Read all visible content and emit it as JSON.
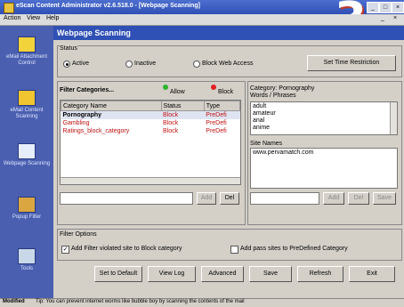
{
  "window": {
    "title": "eScan Content Administrator v2.6.518.0 - [Webpage Scanning]",
    "min": "_",
    "max": "□",
    "close": "×"
  },
  "overlay_number": "3",
  "menu": {
    "items": [
      "Action",
      "View",
      "Help"
    ],
    "child_min": "_",
    "child_close": "×"
  },
  "sidebar": {
    "items": [
      {
        "label": "eMail Attachment Control",
        "icon": "envelope-icon"
      },
      {
        "label": "eMail Content Scanning",
        "icon": "envelope-content-icon"
      },
      {
        "label": "Webpage Scanning",
        "icon": "webpage-icon"
      },
      {
        "label": "Popup Filter",
        "icon": "popup-filter-icon"
      },
      {
        "label": "Tools",
        "icon": "tools-icon"
      }
    ]
  },
  "header": {
    "title": "Webpage Scanning"
  },
  "status_group": {
    "title": "Status",
    "options": [
      "Active",
      "Inactive",
      "Block Web Access"
    ],
    "selected": "Active",
    "set_time_button": "Set Time Restriction"
  },
  "filter_categories": {
    "title": "Filter Categories...",
    "allow": "Allow",
    "block": "Block",
    "columns": [
      "Category Name",
      "Status",
      "Type"
    ],
    "rows": [
      {
        "name": "Pornography",
        "status": "Block",
        "type": "PreDefi",
        "selected": true
      },
      {
        "name": "Gambling",
        "status": "Block",
        "type": "PreDefi",
        "selected": false
      },
      {
        "name": "Ratings_block_category",
        "status": "Block",
        "type": "PreDefi",
        "selected": false
      }
    ],
    "add": "Add",
    "del": "Del"
  },
  "category_detail": {
    "category_label": "Category: Pornography",
    "words_label": "Words / Phrases",
    "words": [
      "adult",
      "amateur",
      "anal",
      "anime"
    ],
    "sites_label": "Site Names",
    "sites": [
      "www.pervamatch.com"
    ],
    "add": "Add",
    "del": "Del",
    "save": "Save"
  },
  "filter_options": {
    "title": "Filter Options",
    "opt1": "Add Filter violated site to Block category",
    "opt1_checked": true,
    "opt2": "Add pass sites to PreDefined Category",
    "opt2_checked": false
  },
  "bottom_buttons": [
    "Set to Default",
    "View Log",
    "Advanced",
    "Save",
    "Refresh",
    "Exit"
  ],
  "statusbar": {
    "left": "Modified",
    "tip": "Tip: You can prevent internet worms like bubble boy by scanning the contents of the mail"
  },
  "colors": {
    "allow": "#2db52d",
    "block": "#e02020",
    "block_text": "#c01010",
    "sidebar": "#4a5fb0",
    "header": "#2f50b4"
  }
}
